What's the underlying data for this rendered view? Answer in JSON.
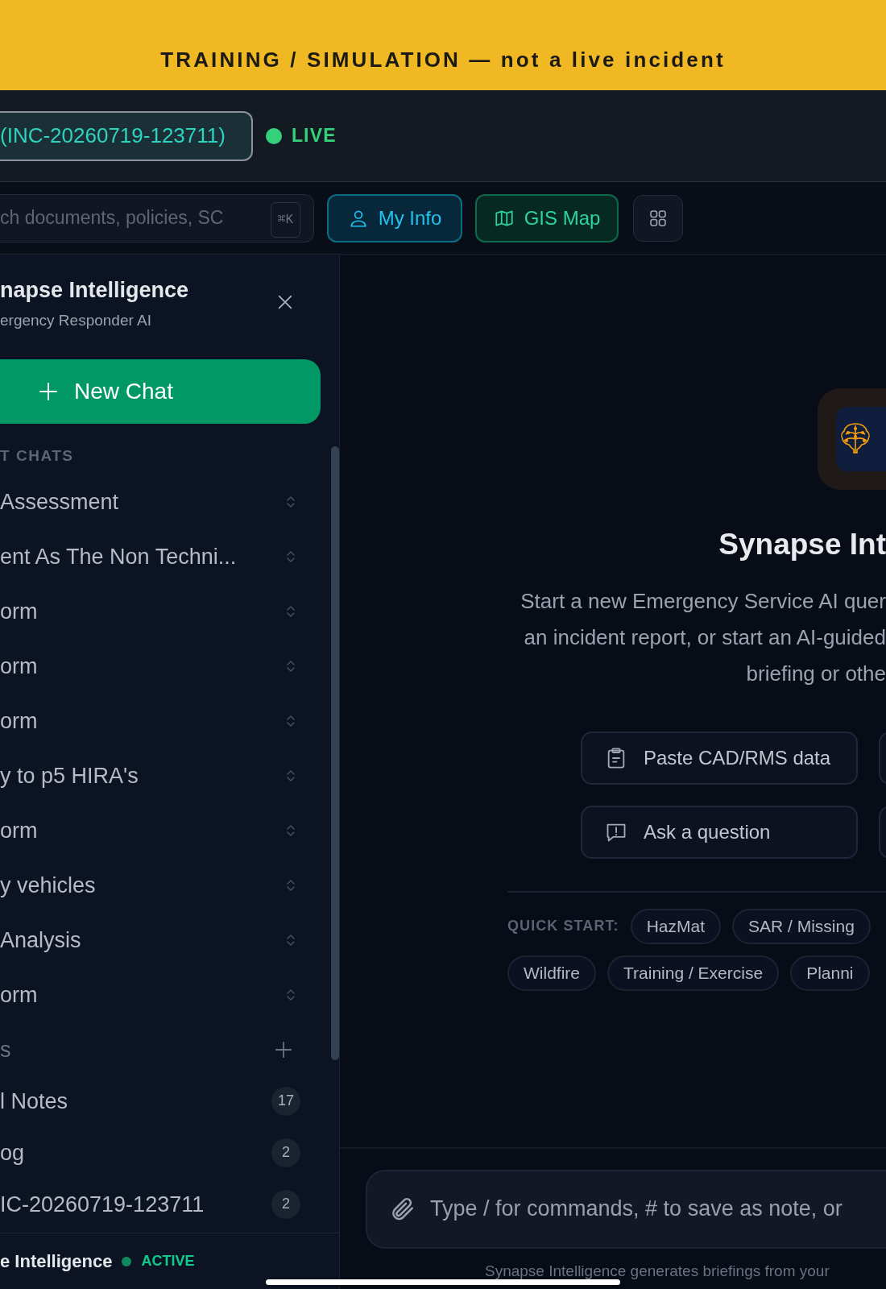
{
  "banner": {
    "text": "TRAINING / SIMULATION — not a live incident"
  },
  "header": {
    "incident": "(INC-20260719-123711)",
    "live": "LIVE"
  },
  "toolbar": {
    "search": {
      "placeholder": "ch documents, policies, SC",
      "shortcut": "⌘K"
    },
    "buttons": [
      {
        "label": "My Info",
        "kind": "profile"
      },
      {
        "label": "GIS Map",
        "kind": "map"
      }
    ]
  },
  "sidebar": {
    "title": "napse Intelligence",
    "subtitle": "ergency Responder AI",
    "new_chat": "New Chat",
    "recent_header": "T CHATS",
    "chats": [
      {
        "title": "Assessment"
      },
      {
        "title": "ent As The Non Techni..."
      },
      {
        "title": "orm"
      },
      {
        "title": "orm"
      },
      {
        "title": "orm"
      },
      {
        "title": "y to p5 HIRA's"
      },
      {
        "title": "orm"
      },
      {
        "title": "y vehicles"
      },
      {
        "title": "Analysis"
      },
      {
        "title": "orm"
      }
    ],
    "notes_header": "s",
    "notes": [
      {
        "title": "l Notes",
        "count": "17"
      },
      {
        "title": "og",
        "count": "2"
      },
      {
        "title": "IC-20260719-123711",
        "count": "2"
      }
    ],
    "footer": {
      "name": "e Intelligence",
      "status": "ACTIVE"
    }
  },
  "main": {
    "title": "Synapse Int",
    "description": [
      "Start a new Emergency Service AI quer",
      "an incident report, or start an AI-guided",
      "briefing or othe"
    ],
    "actions": [
      {
        "label": "Paste CAD/RMS data",
        "kind": "paste"
      },
      {
        "label": "Ask a question",
        "kind": "ask"
      }
    ],
    "quick_start_label": "QUICK START:",
    "chips": [
      [
        "HazMat",
        "SAR / Missing"
      ],
      [
        "Wildfire",
        "Training / Exercise",
        "Planni"
      ]
    ],
    "input": {
      "placeholder": "Type / for commands, # to save as note, or"
    },
    "disclaimer": "Synapse Intelligence generates briefings from your"
  }
}
